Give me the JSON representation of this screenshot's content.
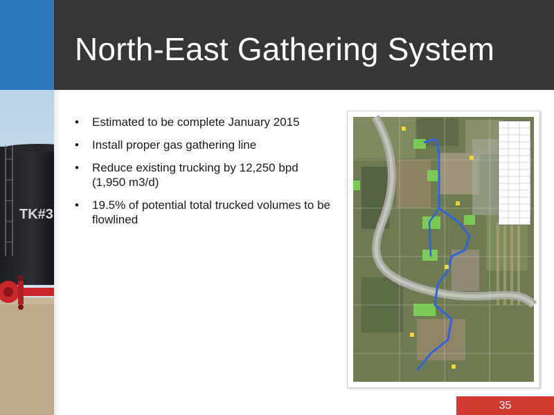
{
  "slide": {
    "title": "North-East Gathering System",
    "page_number": "35",
    "bullets": [
      "Estimated to be complete January 2015",
      "Install proper gas gathering line",
      "Reduce existing trucking by 12,250 bpd (1,950 m3/d)",
      "19.5% of potential total trucked volumes to be flowlined"
    ]
  },
  "photo": {
    "tank_label": "TK#3"
  },
  "colors": {
    "header": "#353638",
    "accent_blue": "#2f78bf",
    "badge_red": "#d13a31",
    "pipeline": "#2f63d8"
  }
}
